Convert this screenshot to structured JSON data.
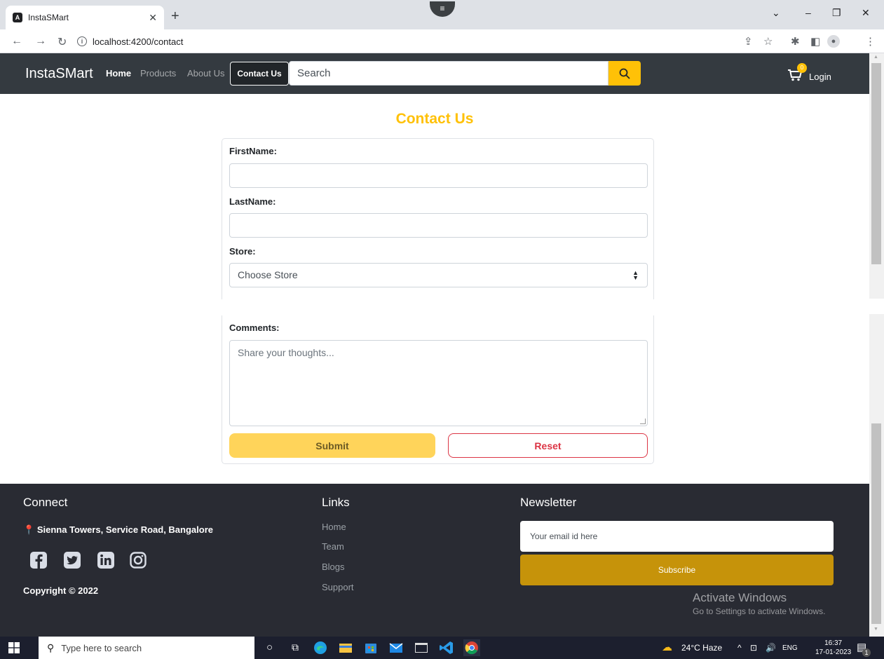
{
  "browser": {
    "tab_title": "InstaSMart",
    "favicon_letter": "A",
    "url": "localhost:4200/contact"
  },
  "navbar": {
    "brand": "InstaSMart",
    "links": [
      "Home",
      "Products",
      "About Us"
    ],
    "contact_button": "Contact Us",
    "search_placeholder": "Search",
    "cart_count": "0",
    "login": "Login"
  },
  "form": {
    "title": "Contact Us",
    "first_name_label": "FirstName:",
    "last_name_label": "LastName:",
    "store_label": "Store:",
    "store_selected": "Choose Store",
    "comments_label": "Comments:",
    "comments_placeholder": "Share your thoughts...",
    "submit_label": "Submit",
    "reset_label": "Reset"
  },
  "footer": {
    "connect_heading": "Connect",
    "address": "Sienna Towers, Service Road, Bangalore",
    "copyright": "Copyright © 2022",
    "links_heading": "Links",
    "links": [
      "Home",
      "Team",
      "Blogs",
      "Support"
    ],
    "newsletter_heading": "Newsletter",
    "email_placeholder": "Your email id here",
    "subscribe_label": "Subscribe",
    "watermark_title": "Activate Windows",
    "watermark_sub": "Go to Settings to activate Windows."
  },
  "taskbar": {
    "search_placeholder": "Type here to search",
    "weather": "24°C  Haze",
    "language": "ENG",
    "time": "16:37",
    "date": "17-01-2023",
    "notification_count": "1"
  },
  "colors": {
    "accent": "#ffc107",
    "navbar_bg": "#343a40",
    "footer_bg": "#292b33",
    "reset_red": "#dc3545",
    "subscribe_gold": "#c6930a"
  }
}
